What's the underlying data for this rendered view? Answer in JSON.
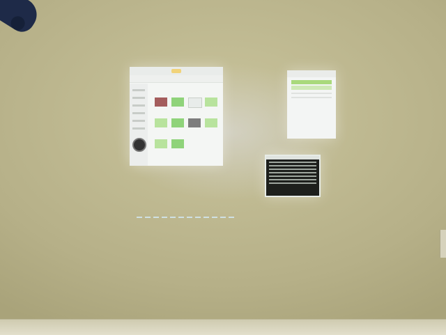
{
  "scene": {
    "description_visible_text": "",
    "colors": {
      "wall": "#b9b48c",
      "projection_glow": "#dcdce1",
      "folder_accent": "#f1d37a",
      "thumbnail_green": "#8fd37a",
      "terminal_bg": "#1d1f1c"
    }
  },
  "icons": {
    "folder": "folder-icon",
    "mount": "projector-mount-icon"
  }
}
